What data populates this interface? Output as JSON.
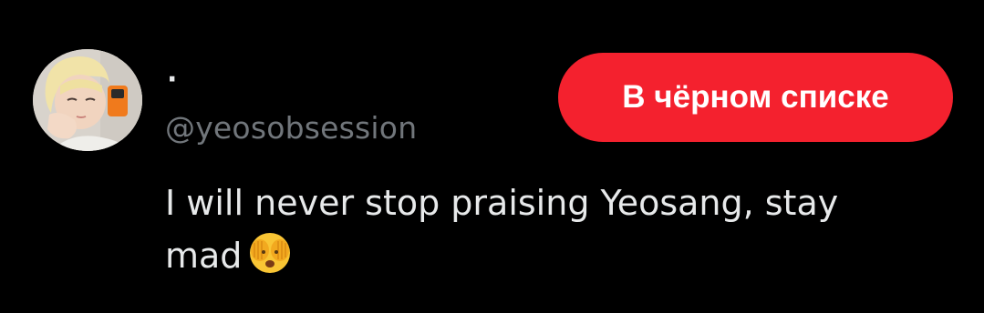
{
  "user": {
    "display_name": "·",
    "handle": "@yeosobsession"
  },
  "block_button": {
    "label": "В чёрном списке",
    "color": "#f4212e"
  },
  "tweet": {
    "text": "I will never stop praising Yeosang, stay mad",
    "emoji_name": "face-with-open-eyes-and-hand-over-mouth-icon"
  },
  "colors": {
    "background": "#000000",
    "text": "#e7e9ea",
    "secondary_text": "#71767b"
  }
}
